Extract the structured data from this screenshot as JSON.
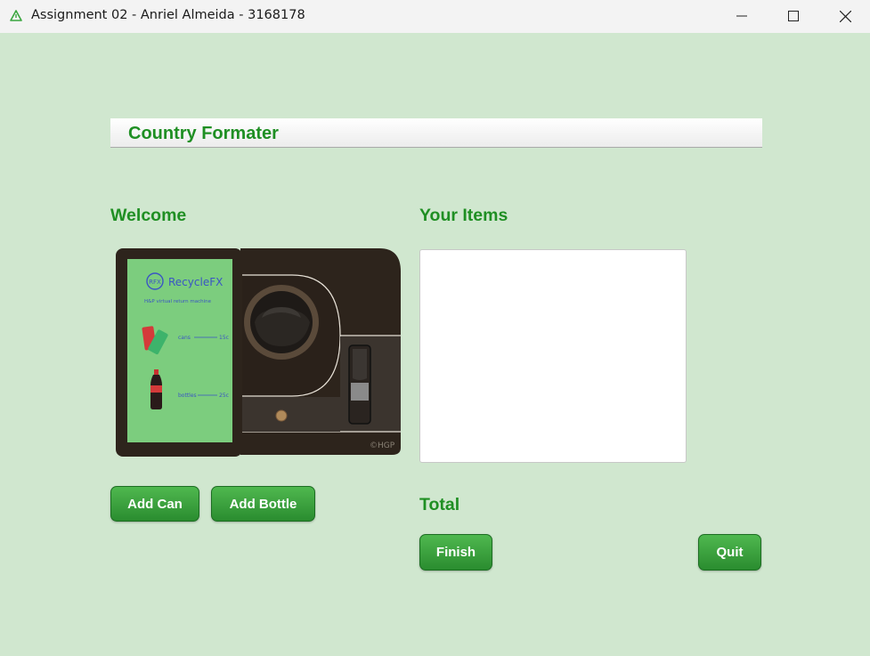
{
  "window": {
    "title": "Assignment 02 - Anriel Almeida - 3168178",
    "icon": "recycle-triangle-icon",
    "controls": [
      "minimize-icon",
      "maximize-icon",
      "close-icon"
    ]
  },
  "header": {
    "title": "Country Formater"
  },
  "welcome": {
    "label": "Welcome",
    "machine_panel": {
      "brand": "RecycleFX",
      "logo_text": "RFX",
      "subtitle": "H&P virtual return machine",
      "cans_label": "cans",
      "cans_price": "15c",
      "bottles_label": "bottles",
      "bottles_price": "25c",
      "signature": "©HGP"
    }
  },
  "buttons": {
    "add_can": "Add Can",
    "add_bottle": "Add Bottle",
    "finish": "Finish",
    "quit": "Quit"
  },
  "items": {
    "label": "Your Items",
    "list": []
  },
  "total": {
    "label": "Total"
  },
  "colors": {
    "background": "#d0e7cf",
    "accent_text": "#1f8f23",
    "button_green": "#2e9633",
    "machine_body": "#2d241c",
    "panel_green": "#7ccd7e"
  }
}
